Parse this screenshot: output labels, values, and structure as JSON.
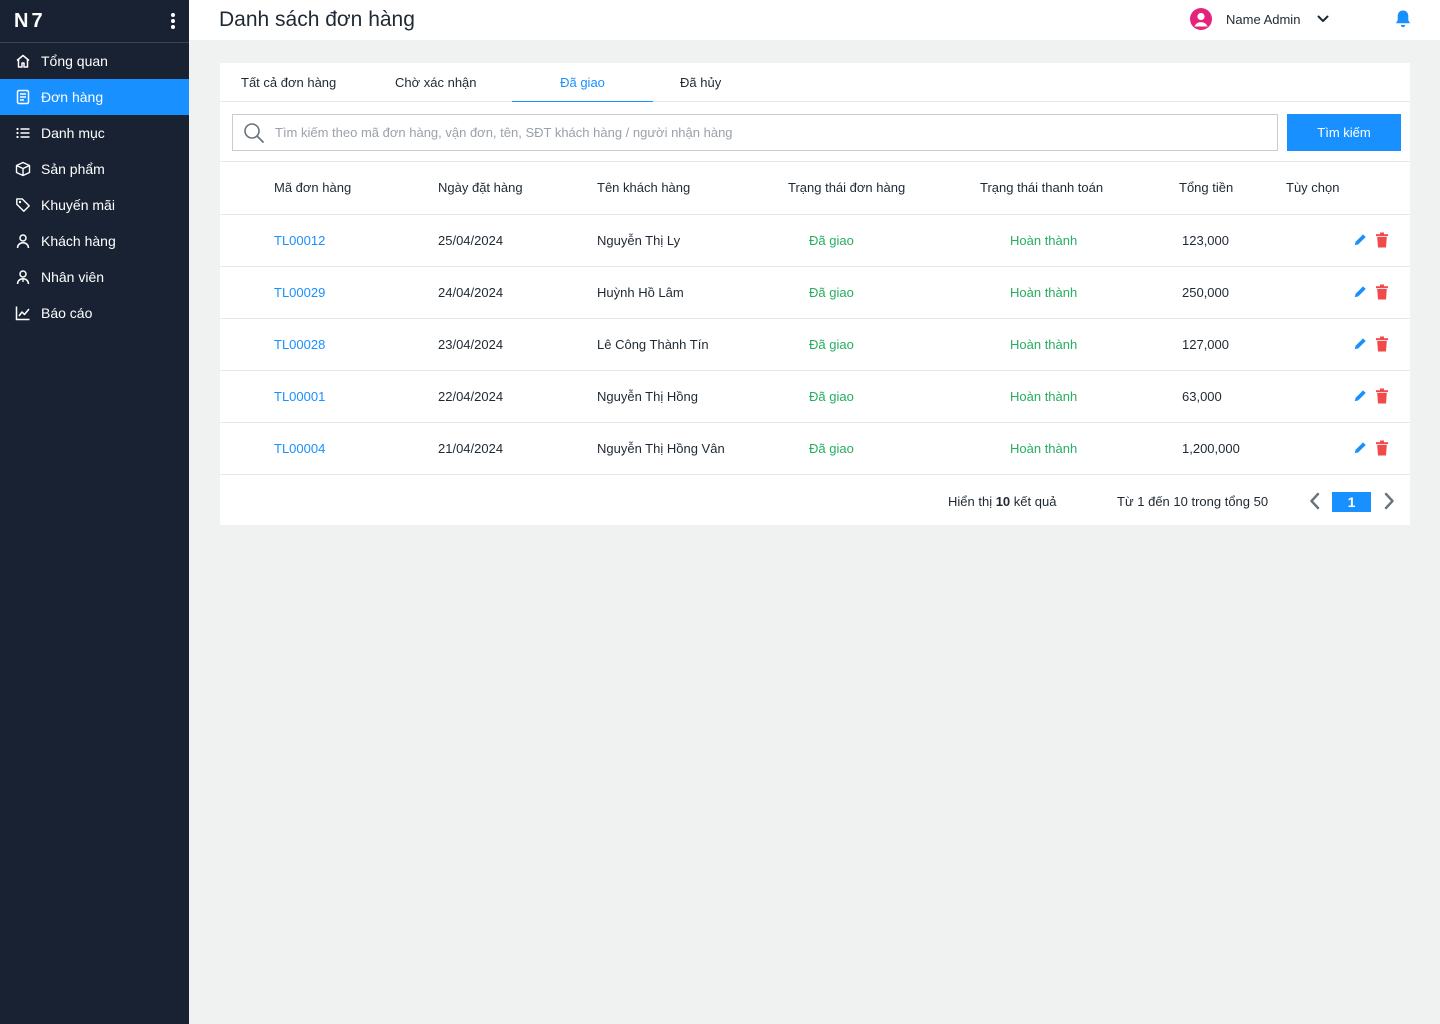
{
  "brand": {
    "logo": "N7"
  },
  "sidebar": {
    "items": [
      {
        "label": "Tổng quan",
        "icon": "home-icon",
        "active": false
      },
      {
        "label": "Đơn hàng",
        "icon": "document-icon",
        "active": true
      },
      {
        "label": "Danh mục",
        "icon": "list-icon",
        "active": false
      },
      {
        "label": "Sản phẩm",
        "icon": "box-icon",
        "active": false
      },
      {
        "label": "Khuyến mãi",
        "icon": "tag-icon",
        "active": false
      },
      {
        "label": "Khách hàng",
        "icon": "user-icon",
        "active": false
      },
      {
        "label": "Nhân viên",
        "icon": "staff-icon",
        "active": false
      },
      {
        "label": "Báo cáo",
        "icon": "chart-icon",
        "active": false
      }
    ]
  },
  "header": {
    "title": "Danh sách đơn hàng",
    "user_name": "Name Admin"
  },
  "tabs": [
    {
      "label": "Tất cả đơn hàng",
      "active": false
    },
    {
      "label": "Chờ xác nhận",
      "active": false
    },
    {
      "label": "Đã giao",
      "active": true
    },
    {
      "label": "Đã hủy",
      "active": false
    }
  ],
  "search": {
    "placeholder": "Tìm kiếm theo mã đơn hàng, vận đơn, tên, SĐT khách hàng / người nhận hàng",
    "value": "",
    "button_label": "Tìm kiếm"
  },
  "table": {
    "columns": [
      "Mã đơn hàng",
      "Ngày đặt hàng",
      "Tên khách hàng",
      "Trạng thái đơn hàng",
      "Trạng thái thanh toán",
      "Tổng tiền",
      "Tùy chọn"
    ],
    "rows": [
      {
        "code": "TL00012",
        "date": "25/04/2024",
        "customer": "Nguyễn Thị Ly",
        "order_status": "Đã giao",
        "payment_status": "Hoàn thành",
        "total": "123,000"
      },
      {
        "code": "TL00029",
        "date": "24/04/2024",
        "customer": "Huỳnh Hồ Lâm",
        "order_status": "Đã giao",
        "payment_status": "Hoàn thành",
        "total": "250,000"
      },
      {
        "code": "TL00028",
        "date": "23/04/2024",
        "customer": "Lê Công Thành Tín",
        "order_status": "Đã giao",
        "payment_status": "Hoàn thành",
        "total": "127,000"
      },
      {
        "code": "TL00001",
        "date": "22/04/2024",
        "customer": "Nguyễn Thị Hồng",
        "order_status": "Đã giao",
        "payment_status": "Hoàn thành",
        "total": "63,000"
      },
      {
        "code": "TL00004",
        "date": "21/04/2024",
        "customer": "Nguyễn Thị Hồng Vân",
        "order_status": "Đã giao",
        "payment_status": "Hoàn thành",
        "total": "1,200,000"
      }
    ]
  },
  "footer": {
    "showing_prefix": "Hiển thị",
    "showing_count": "10",
    "showing_suffix": "kết quả",
    "range_text": "Từ 1 đến 10 trong tổng 50",
    "current_page": "1"
  },
  "colors": {
    "sidebar_bg": "#192233",
    "accent": "#1890ff",
    "success": "#27ae60",
    "danger": "#f04a4a",
    "avatar": "#e4247a"
  }
}
